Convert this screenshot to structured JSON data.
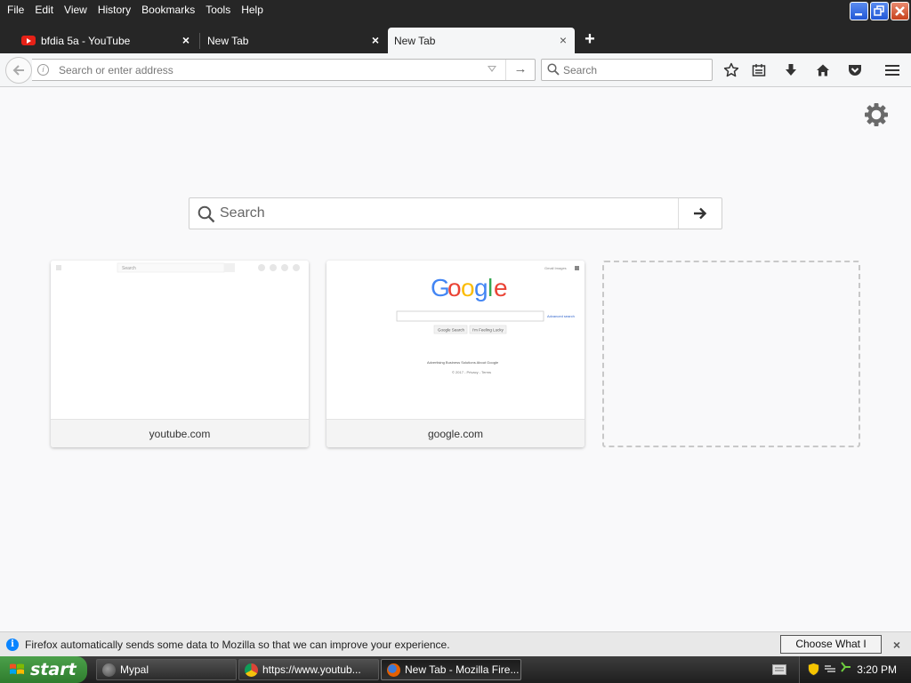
{
  "menubar": {
    "items": [
      {
        "label": "File"
      },
      {
        "label": "Edit"
      },
      {
        "label": "View"
      },
      {
        "label": "History"
      },
      {
        "label": "Bookmarks"
      },
      {
        "label": "Tools"
      },
      {
        "label": "Help"
      }
    ]
  },
  "tabs": [
    {
      "label": "bfdia 5a - YouTube",
      "icon": "youtube-icon",
      "selected": false
    },
    {
      "label": "New Tab",
      "selected": false
    },
    {
      "label": "New Tab",
      "selected": true
    }
  ],
  "navbar": {
    "url_placeholder": "Search or enter address",
    "url_value": "",
    "search_placeholder": "Search"
  },
  "newtab": {
    "search_placeholder": "Search",
    "tiles": [
      {
        "title": "youtube.com"
      },
      {
        "title": "google.com"
      }
    ],
    "google_thumb": {
      "logo": "Google",
      "btn1": "Google Search",
      "btn2": "I'm Feeling Lucky",
      "footer": "Advertising   Business Solutions   About Google",
      "footer2": "© 2017 - Privacy - Terms"
    },
    "youtube_thumb": {
      "search_text": "Search"
    }
  },
  "notification": {
    "text": "Firefox automatically sends some data to Mozilla so that we can improve your experience.",
    "button": "Choose What I Share"
  },
  "taskbar": {
    "start_label": "start",
    "tasks": [
      {
        "label": "Mypal",
        "active": false
      },
      {
        "label": "https://www.youtub...",
        "active": false
      },
      {
        "label": "New Tab - Mozilla Fire...",
        "active": true
      }
    ],
    "clock": "3:20 PM"
  },
  "colors": {
    "chrome": "#262626",
    "toolbar": "#f5f6f7",
    "content": "#f9f9fa",
    "accent": "#0a84ff"
  }
}
